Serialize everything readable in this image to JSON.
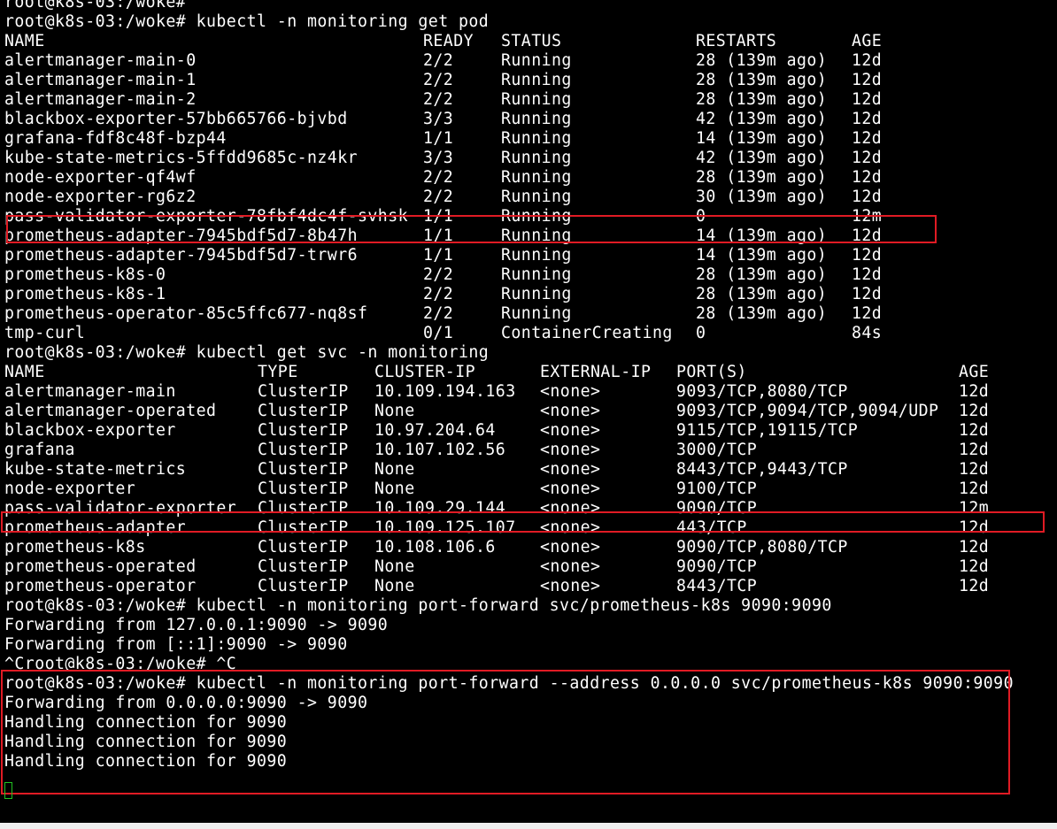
{
  "terminal": {
    "pre_lines": [
      "root@k8s-03:/woke#",
      "root@k8s-03:/woke# kubectl -n monitoring get pod"
    ],
    "pods": {
      "headers": [
        "NAME",
        "READY",
        "STATUS",
        "RESTARTS",
        "AGE"
      ],
      "rows": [
        [
          "alertmanager-main-0",
          "2/2",
          "Running",
          "28 (139m ago)",
          "12d"
        ],
        [
          "alertmanager-main-1",
          "2/2",
          "Running",
          "28 (139m ago)",
          "12d"
        ],
        [
          "alertmanager-main-2",
          "2/2",
          "Running",
          "28 (139m ago)",
          "12d"
        ],
        [
          "blackbox-exporter-57bb665766-bjvbd",
          "3/3",
          "Running",
          "42 (139m ago)",
          "12d"
        ],
        [
          "grafana-fdf8c48f-bzp44",
          "1/1",
          "Running",
          "14 (139m ago)",
          "12d"
        ],
        [
          "kube-state-metrics-5ffdd9685c-nz4kr",
          "3/3",
          "Running",
          "42 (139m ago)",
          "12d"
        ],
        [
          "node-exporter-qf4wf",
          "2/2",
          "Running",
          "28 (139m ago)",
          "12d"
        ],
        [
          "node-exporter-rg6z2",
          "2/2",
          "Running",
          "30 (139m ago)",
          "12d"
        ],
        [
          "pass-validator-exporter-78fbf4dc4f-svhsk",
          "1/1",
          "Running",
          "0",
          "12m"
        ],
        [
          "prometheus-adapter-7945bdf5d7-8b47h",
          "1/1",
          "Running",
          "14 (139m ago)",
          "12d"
        ],
        [
          "prometheus-adapter-7945bdf5d7-trwr6",
          "1/1",
          "Running",
          "14 (139m ago)",
          "12d"
        ],
        [
          "prometheus-k8s-0",
          "2/2",
          "Running",
          "28 (139m ago)",
          "12d"
        ],
        [
          "prometheus-k8s-1",
          "2/2",
          "Running",
          "28 (139m ago)",
          "12d"
        ],
        [
          "prometheus-operator-85c5ffc677-nq8sf",
          "2/2",
          "Running",
          "28 (139m ago)",
          "12d"
        ],
        [
          "tmp-curl",
          "0/1",
          "ContainerCreating",
          "0",
          "84s"
        ]
      ]
    },
    "svc_command": "root@k8s-03:/woke# kubectl get svc -n monitoring",
    "services": {
      "headers": [
        "NAME",
        "TYPE",
        "CLUSTER-IP",
        "EXTERNAL-IP",
        "PORT(S)",
        "AGE"
      ],
      "rows": [
        [
          "alertmanager-main",
          "ClusterIP",
          "10.109.194.163",
          "<none>",
          "9093/TCP,8080/TCP",
          "12d"
        ],
        [
          "alertmanager-operated",
          "ClusterIP",
          "None",
          "<none>",
          "9093/TCP,9094/TCP,9094/UDP",
          "12d"
        ],
        [
          "blackbox-exporter",
          "ClusterIP",
          "10.97.204.64",
          "<none>",
          "9115/TCP,19115/TCP",
          "12d"
        ],
        [
          "grafana",
          "ClusterIP",
          "10.107.102.56",
          "<none>",
          "3000/TCP",
          "12d"
        ],
        [
          "kube-state-metrics",
          "ClusterIP",
          "None",
          "<none>",
          "8443/TCP,9443/TCP",
          "12d"
        ],
        [
          "node-exporter",
          "ClusterIP",
          "None",
          "<none>",
          "9100/TCP",
          "12d"
        ],
        [
          "pass-validator-exporter",
          "ClusterIP",
          "10.109.29.144",
          "<none>",
          "9090/TCP",
          "12m"
        ],
        [
          "prometheus-adapter",
          "ClusterIP",
          "10.109.125.107",
          "<none>",
          "443/TCP",
          "12d"
        ],
        [
          "prometheus-k8s",
          "ClusterIP",
          "10.108.106.6",
          "<none>",
          "9090/TCP,8080/TCP",
          "12d"
        ],
        [
          "prometheus-operated",
          "ClusterIP",
          "None",
          "<none>",
          "9090/TCP",
          "12d"
        ],
        [
          "prometheus-operator",
          "ClusterIP",
          "None",
          "<none>",
          "8443/TCP",
          "12d"
        ]
      ]
    },
    "post_lines": [
      "root@k8s-03:/woke# kubectl -n monitoring port-forward svc/prometheus-k8s 9090:9090",
      "Forwarding from 127.0.0.1:9090 -> 9090",
      "Forwarding from [::1]:9090 -> 9090",
      "^Croot@k8s-03:/woke# ^C",
      "root@k8s-03:/woke# kubectl -n monitoring port-forward --address 0.0.0.0 svc/prometheus-k8s 9090:9090",
      "Forwarding from 0.0.0.0:9090 -> 9090",
      "Handling connection for 9090",
      "Handling connection for 9090",
      "Handling connection for 9090"
    ],
    "colors": {
      "background": "#000000",
      "text": "#ffffff",
      "highlight": "#e01b24",
      "cursor": "#22c322"
    },
    "icons": [
      "cursor-block"
    ]
  }
}
